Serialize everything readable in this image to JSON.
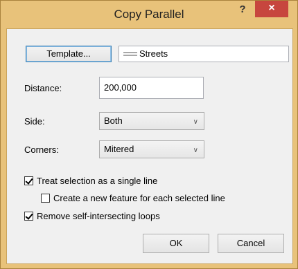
{
  "window": {
    "title": "Copy Parallel",
    "help_glyph": "?",
    "close_glyph": "×"
  },
  "template": {
    "button_label": "Template...",
    "value": "Streets",
    "icon": "line-symbol-icon"
  },
  "distance": {
    "label": "Distance:",
    "value": "200,000"
  },
  "side": {
    "label": "Side:",
    "value": "Both"
  },
  "corners": {
    "label": "Corners:",
    "value": "Mitered"
  },
  "options": {
    "treat_single_line": {
      "label": "Treat selection as a single line",
      "checked": true
    },
    "create_new_feature": {
      "label": "Create a new feature for each selected line",
      "checked": false
    },
    "remove_loops": {
      "label": "Remove self-intersecting loops",
      "checked": true
    }
  },
  "buttons": {
    "ok": "OK",
    "cancel": "Cancel"
  },
  "colors": {
    "titlebar": "#e8c27a",
    "close": "#c7463e",
    "client": "#f0f0f0"
  }
}
